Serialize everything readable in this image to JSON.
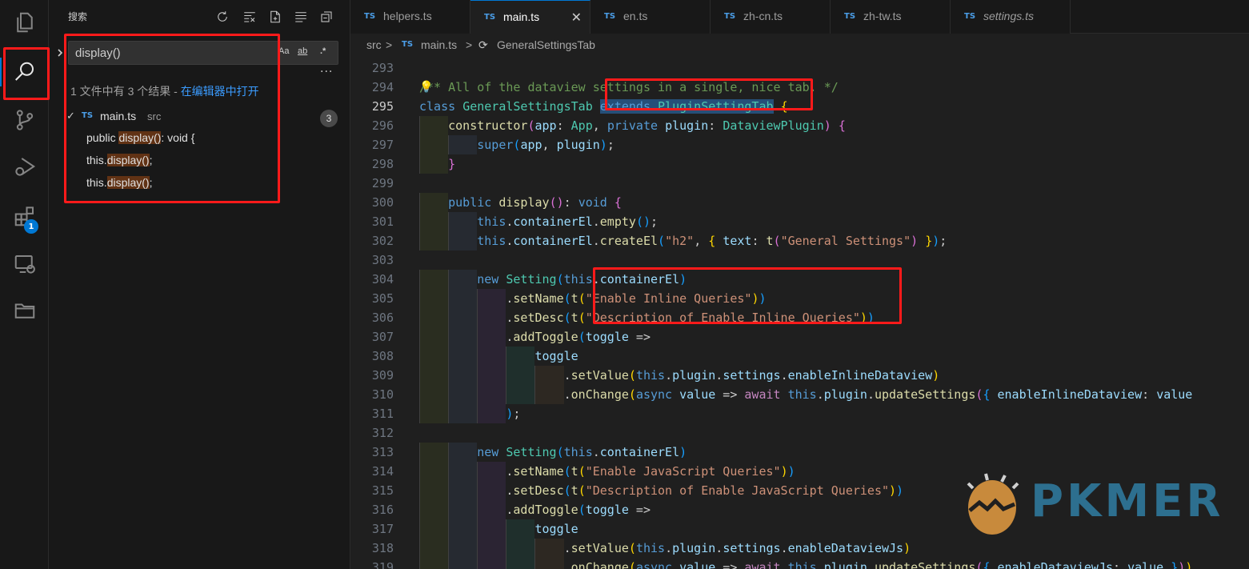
{
  "activity_bar": {
    "items": [
      {
        "icon": "files-icon"
      },
      {
        "icon": "search-icon",
        "active": true
      },
      {
        "icon": "source-control-icon"
      },
      {
        "icon": "run-debug-icon"
      },
      {
        "icon": "extensions-icon",
        "badge": "1"
      },
      {
        "icon": "remote-explorer-icon"
      },
      {
        "icon": "folder-icon"
      }
    ]
  },
  "sidebar": {
    "title": "搜索",
    "search": {
      "value": "display()",
      "options": [
        "Aa",
        "ab",
        ".*"
      ]
    },
    "more": "···",
    "summary_prefix": "1 文件中有 3 个结果 - ",
    "summary_link": "在编辑器中打开",
    "results": {
      "file_check": "✓",
      "file_badge": "TS",
      "file_name": "main.ts",
      "file_dir": "src",
      "count": "3",
      "matches": [
        {
          "before": "public ",
          "match": "display()",
          "after": ": void {"
        },
        {
          "before": "this.",
          "match": "display()",
          "after": ";"
        },
        {
          "before": "this.",
          "match": "display()",
          "after": ";"
        }
      ]
    }
  },
  "tabs": [
    {
      "badge": "TS",
      "label": "helpers.ts",
      "active": false
    },
    {
      "badge": "TS",
      "label": "main.ts",
      "active": true,
      "close": "✕"
    },
    {
      "badge": "TS",
      "label": "en.ts",
      "active": false
    },
    {
      "badge": "TS",
      "label": "zh-cn.ts",
      "active": false
    },
    {
      "badge": "TS",
      "label": "zh-tw.ts",
      "active": false
    },
    {
      "badge": "TS",
      "label": "settings.ts",
      "active": false,
      "italic": true
    }
  ],
  "breadcrumb": {
    "folder": "src",
    "sep": ">",
    "file_badge": "TS",
    "file": "main.ts",
    "symbol": "GeneralSettingsTab"
  },
  "editor": {
    "current_line": "295",
    "lines": [
      {
        "n": "293",
        "text": ""
      },
      {
        "n": "294",
        "text": "/** All of the dataview settings in a single, nice tab. */"
      },
      {
        "n": "295",
        "text": "class GeneralSettingsTab extends PluginSettingTab {"
      },
      {
        "n": "296",
        "text": "    constructor(app: App, private plugin: DataviewPlugin) {"
      },
      {
        "n": "297",
        "text": "        super(app, plugin);"
      },
      {
        "n": "298",
        "text": "    }"
      },
      {
        "n": "299",
        "text": ""
      },
      {
        "n": "300",
        "text": "    public display(): void {"
      },
      {
        "n": "301",
        "text": "        this.containerEl.empty();"
      },
      {
        "n": "302",
        "text": "        this.containerEl.createEl(\"h2\", { text: t(\"General Settings\") });"
      },
      {
        "n": "303",
        "text": ""
      },
      {
        "n": "304",
        "text": "        new Setting(this.containerEl)"
      },
      {
        "n": "305",
        "text": "            .setName(t(\"Enable Inline Queries\"))"
      },
      {
        "n": "306",
        "text": "            .setDesc(t(\"Description of Enable Inline Queries\"))"
      },
      {
        "n": "307",
        "text": "            .addToggle(toggle =>"
      },
      {
        "n": "308",
        "text": "                toggle"
      },
      {
        "n": "309",
        "text": "                    .setValue(this.plugin.settings.enableInlineDataview)"
      },
      {
        "n": "310",
        "text": "                    .onChange(async value => await this.plugin.updateSettings({ enableInlineDataview: value"
      },
      {
        "n": "311",
        "text": "            );"
      },
      {
        "n": "312",
        "text": ""
      },
      {
        "n": "313",
        "text": "        new Setting(this.containerEl)"
      },
      {
        "n": "314",
        "text": "            .setName(t(\"Enable JavaScript Queries\"))"
      },
      {
        "n": "315",
        "text": "            .setDesc(t(\"Description of Enable JavaScript Queries\"))"
      },
      {
        "n": "316",
        "text": "            .addToggle(toggle =>"
      },
      {
        "n": "317",
        "text": "                toggle"
      },
      {
        "n": "318",
        "text": "                    .setValue(this.plugin.settings.enableDataviewJs)"
      },
      {
        "n": "319",
        "text": "                    .onChange(async value => await this.plugin.updateSettings({ enableDataviewJs: value }))"
      }
    ]
  },
  "watermark": {
    "text": "PKMER"
  },
  "colors": {
    "accent": "#0078d4",
    "annotation": "#ff1a1a",
    "find_highlight": "#613214",
    "selection": "#264f78"
  }
}
